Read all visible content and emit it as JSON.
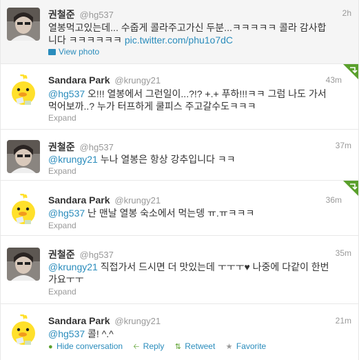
{
  "tweets": [
    {
      "name": "권철준",
      "handle": "@hg537",
      "time": "2h",
      "text_line1": "열봉먹고있는데... 수줍게 콜라주고가신 두분...ㅋㅋㅋㅋㅋ 콜라 감사합",
      "text_line2_prefix": "니다 ㅋㅋㅋㅋㅋㅋ ",
      "link": "pic.twitter.com/phu1o7dC",
      "action": "View photo"
    },
    {
      "name": "Sandara Park",
      "handle": "@krungy21",
      "time": "43m",
      "mention": "@hg537",
      "text_line1_rest": " 오!!! 열봉에서 그런일이...?!? +.+ 푸하!!!ㅋㅋ 그럼 나도 가서",
      "text_line2": "먹어보까..? 누가 터프하게 쿨피스 주고갈수도ㅋㅋㅋ",
      "action": "Expand"
    },
    {
      "name": "권철준",
      "handle": "@hg537",
      "time": "37m",
      "mention": "@krungy21",
      "text_rest": " 누나 열봉은 항상 강추입니다 ㅋㅋ",
      "action": "Expand"
    },
    {
      "name": "Sandara Park",
      "handle": "@krungy21",
      "time": "36m",
      "mention": "@hg537",
      "text_rest": " 난 맨날 열봉 숙소에서 먹는뎅 ㅠ.ㅠㅋㅋㅋ",
      "action": "Expand"
    },
    {
      "name": "권철준",
      "handle": "@hg537",
      "time": "35m",
      "mention": "@krungy21",
      "text_line1_rest": " 직접가서 드시면 더 맛있는데 ㅜㅜㅜ♥ 나중에 다같이 한번",
      "text_line2": "가요ㅜㅜ",
      "action": "Expand"
    },
    {
      "name": "Sandara Park",
      "handle": "@krungy21",
      "time": "21m",
      "mention": "@hg537",
      "text_rest": " 콜! ^.^",
      "actions": {
        "hide": "Hide conversation",
        "reply": "Reply",
        "retweet": "Retweet",
        "favorite": "Favorite"
      }
    }
  ],
  "icons": {
    "ribbon": "retweet-ribbon-icon",
    "speech": "speech-bubble-icon",
    "reply": "reply-arrow-icon",
    "retweet": "retweet-icon",
    "favorite": "star-icon"
  },
  "colors": {
    "link": "#2a8cbc",
    "muted": "#999999",
    "text": "#333333",
    "ribbon": "#5aa02c"
  }
}
